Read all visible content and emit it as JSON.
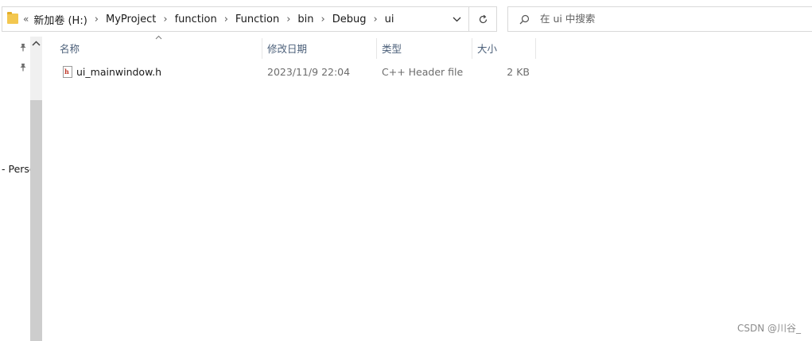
{
  "address_bar": {
    "overflow_label": "«",
    "crumbs": [
      "新加卷 (H:)",
      "MyProject",
      "function",
      "Function",
      "bin",
      "Debug",
      "ui"
    ],
    "separator": "›"
  },
  "search": {
    "placeholder": "在 ui 中搜索"
  },
  "nav_pane": {
    "partial_item": "- Persc"
  },
  "columns": {
    "name": "名称",
    "date": "修改日期",
    "type": "类型",
    "size": "大小"
  },
  "files": [
    {
      "name": "ui_mainwindow.h",
      "modified": "2023/11/9 22:04",
      "type": "C++ Header file",
      "size": "2 KB",
      "icon_label": "h"
    }
  ],
  "watermark": "CSDN @川谷_",
  "colors": {
    "folder": "#f3c74f",
    "header_text": "#4c607a",
    "scrollbar_thumb": "#cdcdcd"
  },
  "icons": [
    "folder-icon",
    "chevron-down-icon",
    "refresh-icon",
    "search-icon",
    "pin-icon",
    "scroll-up-arrow-icon",
    "sort-ascending-icon",
    "cpp-header-file-icon"
  ]
}
